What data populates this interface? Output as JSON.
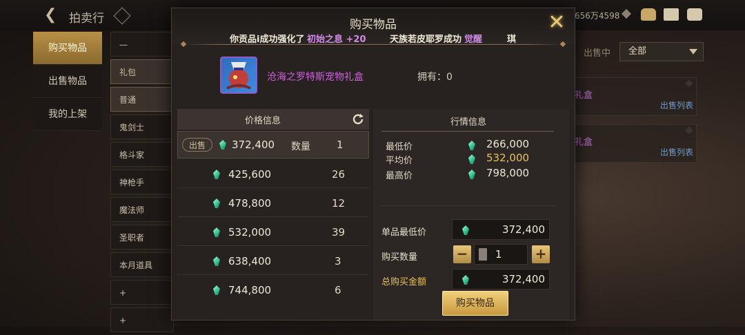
{
  "topbar": {
    "title": "拍卖行",
    "currency_text": "656万4598"
  },
  "left_nav": [
    {
      "label": "购买物品",
      "active": true
    },
    {
      "label": "出售物品",
      "active": false
    },
    {
      "label": "我的上架",
      "active": false
    }
  ],
  "categories": [
    {
      "label": "—",
      "selected": false
    },
    {
      "label": "礼包",
      "selected": true
    },
    {
      "label": "普通",
      "selected": true
    },
    {
      "label": "鬼剑士",
      "selected": false
    },
    {
      "label": "格斗家",
      "selected": false
    },
    {
      "label": "神枪手",
      "selected": false
    },
    {
      "label": "魔法师",
      "selected": false
    },
    {
      "label": "圣职者",
      "selected": false
    },
    {
      "label": "本月道具",
      "selected": false
    },
    {
      "label": "+",
      "selected": false
    },
    {
      "label": "+",
      "selected": false
    }
  ],
  "right_filter": {
    "label": "出售中",
    "value": "全部"
  },
  "background_rows": [
    {
      "text": "礼盒",
      "link": "出售列表"
    },
    {
      "text": "礼盒",
      "link": "出售列表"
    }
  ],
  "modal": {
    "title": "购买物品",
    "ticker": {
      "part1": "你贡品i成功强化了",
      "highlight1": "初始之息 +20",
      "part2": "天族若皮耶罗成功",
      "highlight2": "觉醒",
      "part3": "琪"
    },
    "item_name": "沧海之罗特斯宠物礼盒",
    "own_label": "拥有：0",
    "price_header": "价格信息",
    "sell_tag": "出售",
    "qty_label": "数量",
    "listings": [
      {
        "price": "372,400",
        "qty": "1"
      },
      {
        "price": "425,600",
        "qty": "26"
      },
      {
        "price": "478,800",
        "qty": "12"
      },
      {
        "price": "532,000",
        "qty": "39"
      },
      {
        "price": "638,400",
        "qty": "3"
      },
      {
        "price": "744,800",
        "qty": "6"
      }
    ],
    "market": {
      "title": "行情信息",
      "min_label": "最低价",
      "min_value": "266,000",
      "avg_label": "平均价",
      "avg_value": "532,000",
      "max_label": "最高价",
      "max_value": "798,000"
    },
    "form": {
      "unit_min_label": "单品最低价",
      "unit_min_value": "372,400",
      "qty_label": "购买数量",
      "qty_value": "1",
      "minus": "−",
      "plus": "+",
      "total_label": "总购买金额",
      "total_value": "372,400"
    },
    "buy_button": "购买物品"
  },
  "colors": {
    "accent_gold": "#e9c253",
    "item_purple": "#cf5fe0",
    "gem_teal": "#2bbf8d"
  },
  "icons": [
    "back-arrow-icon",
    "emblem-icon",
    "diamond-icon",
    "bag-icon",
    "mail-icon",
    "chat-icon",
    "close-icon",
    "refresh-icon",
    "gem-icon",
    "calculator-icon",
    "caret-down-icon"
  ]
}
